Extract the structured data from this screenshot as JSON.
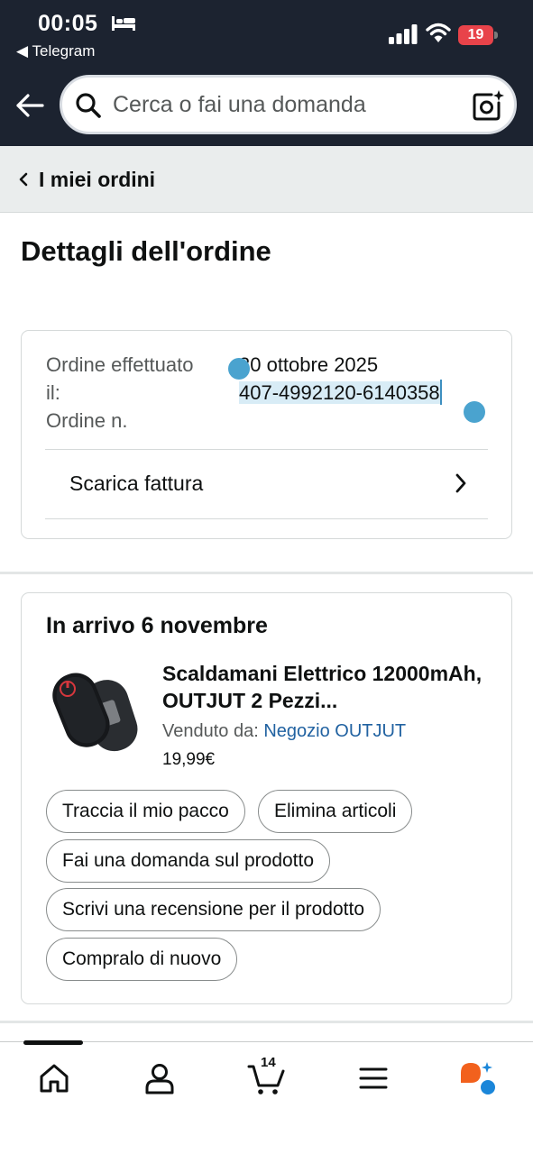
{
  "status_bar": {
    "time": "00:05",
    "back_app": "◀ Telegram",
    "battery": "19",
    "battery_color": "#e8434a"
  },
  "header": {
    "search_placeholder": "Cerca o fai una domanda",
    "background": "#1c2330"
  },
  "breadcrumb": {
    "label": "I miei ordini"
  },
  "page": {
    "title": "Dettagli dell'ordine"
  },
  "order_info": {
    "date_label": "Ordine effettuato il:",
    "number_label": "Ordine n.",
    "date_value": "30 ottobre 2025",
    "number_value": "407-4992120-6140358",
    "invoice_label": "Scarica fattura"
  },
  "shipment": {
    "arrival": "In arrivo 6 novembre",
    "product_title": "Scaldamani Elettrico 12000mAh, OUTJUT 2 Pezzi...",
    "seller_prefix": "Venduto da: ",
    "seller_name": "Negozio OUTJUT",
    "price": "19,99€",
    "link_color": "#2162a1",
    "actions": [
      "Traccia il mio pacco",
      "Elimina articoli",
      "Fai una domanda sul prodotto",
      "Scrivi una recensione per il prodotto",
      "Compralo di nuovo"
    ]
  },
  "bottom_nav": {
    "cart_count": "14",
    "items": [
      "home-icon",
      "account-icon",
      "cart-icon",
      "menu-icon",
      "rufus-assistant-icon"
    ]
  }
}
